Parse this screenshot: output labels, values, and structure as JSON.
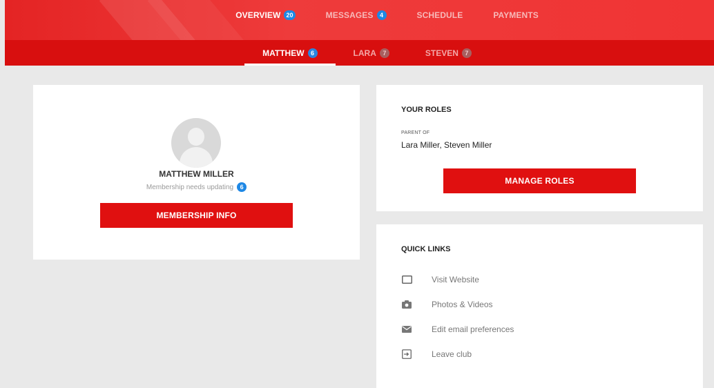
{
  "top_tabs": [
    {
      "label": "OVERVIEW",
      "badge": "20"
    },
    {
      "label": "MESSAGES",
      "badge": "4"
    },
    {
      "label": "SCHEDULE"
    },
    {
      "label": "PAYMENTS"
    }
  ],
  "member_tabs": [
    {
      "label": "MATTHEW",
      "badge": "6"
    },
    {
      "label": "LARA",
      "badge": "7"
    },
    {
      "label": "STEVEN",
      "badge": "7"
    }
  ],
  "profile": {
    "name": "MATTHEW MILLER",
    "status": "Membership needs updating",
    "status_badge": "6",
    "button": "MEMBERSHIP INFO",
    "avatar_icon": "user-avatar-placeholder"
  },
  "roles": {
    "title": "YOUR ROLES",
    "caption": "PARENT OF",
    "value": "Lara Miller, Steven Miller",
    "button": "MANAGE ROLES"
  },
  "quick_links": {
    "title": "QUICK LINKS",
    "items": [
      {
        "label": "Visit Website",
        "icon": "window-icon"
      },
      {
        "label": "Photos & Videos",
        "icon": "camera-icon"
      },
      {
        "label": "Edit email preferences",
        "icon": "envelope-icon"
      },
      {
        "label": "Leave club",
        "icon": "exit-icon"
      }
    ]
  },
  "colors": {
    "primary_red": "#e01010",
    "nav_red": "#ee3b3b",
    "subnav_red": "#d80f0f",
    "badge_blue": "#1e88e5"
  }
}
